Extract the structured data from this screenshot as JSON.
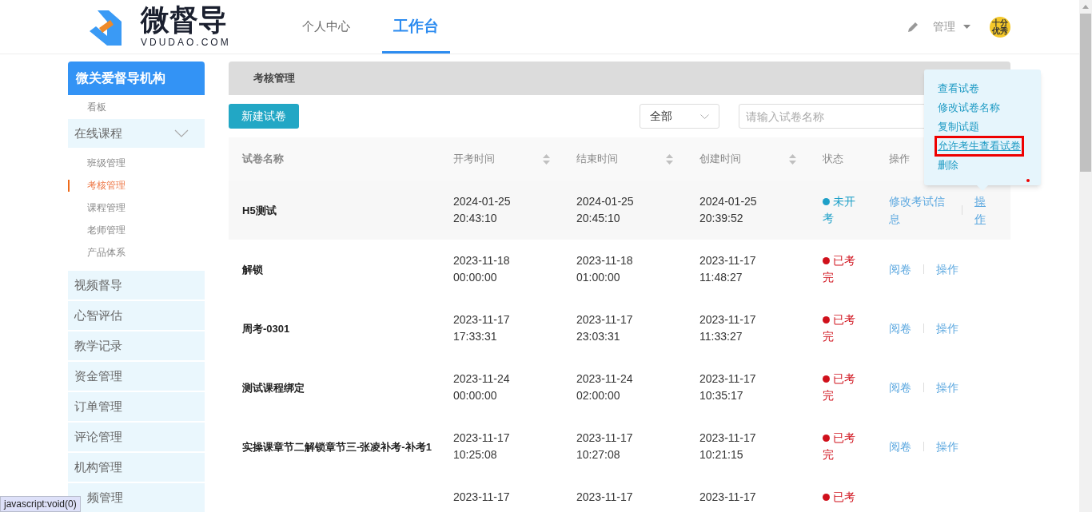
{
  "header": {
    "logo": {
      "name": "微督导",
      "domain": "VDUDAO.COM"
    },
    "nav": [
      {
        "label": "个人中心",
        "selected": false
      },
      {
        "label": "工作台",
        "selected": true
      }
    ],
    "user": {
      "menu": "管理",
      "avatar_text": "十分优秀"
    }
  },
  "sidebar": {
    "org": "微关爱督导机构",
    "items": [
      {
        "kind": "sub",
        "label": "看板",
        "selected": false
      },
      {
        "kind": "group",
        "label": "在线课程",
        "expanded": true,
        "children": [
          {
            "label": "班级管理",
            "selected": false
          },
          {
            "label": "考核管理",
            "selected": true
          },
          {
            "label": "课程管理",
            "selected": false
          },
          {
            "label": "老师管理",
            "selected": false
          },
          {
            "label": "产品体系",
            "selected": false
          }
        ]
      },
      {
        "kind": "item",
        "label": "视频督导",
        "selected": false
      },
      {
        "kind": "item",
        "label": "心智评估",
        "selected": false
      },
      {
        "kind": "item",
        "label": "教学记录",
        "selected": false
      },
      {
        "kind": "item",
        "label": "资金管理",
        "selected": false
      },
      {
        "kind": "item",
        "label": "订单管理",
        "selected": false
      },
      {
        "kind": "item",
        "label": "评论管理",
        "selected": false
      },
      {
        "kind": "item",
        "label": "机构管理",
        "selected": false
      },
      {
        "kind": "item",
        "label": "频管理",
        "selected": false,
        "covered": true
      }
    ]
  },
  "page": {
    "title": "考核管理",
    "new_button": "新建试卷",
    "filter": {
      "value": "全部"
    },
    "search": {
      "placeholder": "请输入试卷名称"
    },
    "table": {
      "columns": [
        {
          "label": "试卷名称",
          "sortable": false
        },
        {
          "label": "开考时间",
          "sortable": true
        },
        {
          "label": "结束时间",
          "sortable": true
        },
        {
          "label": "创建时间",
          "sortable": true
        },
        {
          "label": "状态",
          "sortable": false
        },
        {
          "label": "操作",
          "sortable": false
        }
      ],
      "rows": [
        {
          "name": "H5测试",
          "start": "2024-01-25 20:43:10",
          "end": "2024-01-25 20:45:10",
          "created": "2024-01-25 20:39:52",
          "status": {
            "label": "未开考",
            "color": "#1ea0c8"
          },
          "hovered": true,
          "actions": [
            {
              "label": "修改考试信息",
              "active": false
            },
            {
              "label": "操作",
              "active": true
            }
          ]
        },
        {
          "name": "解锁",
          "start": "2023-11-18 00:00:00",
          "end": "2023-11-18 01:00:00",
          "created": "2023-11-17 11:48:27",
          "status": {
            "label": "已考完",
            "color": "#d0101b"
          },
          "actions": [
            {
              "label": "阅卷",
              "active": false
            },
            {
              "label": "操作",
              "active": false
            }
          ]
        },
        {
          "name": "周考-0301",
          "start": "2023-11-17 17:33:31",
          "end": "2023-11-17 23:03:31",
          "created": "2023-11-17 11:33:27",
          "status": {
            "label": "已考完",
            "color": "#d0101b"
          },
          "actions": [
            {
              "label": "阅卷",
              "active": false
            },
            {
              "label": "操作",
              "active": false
            }
          ]
        },
        {
          "name": "测试课程绑定",
          "start": "2023-11-24 00:00:00",
          "end": "2023-11-24 02:00:00",
          "created": "2023-11-17 10:35:17",
          "status": {
            "label": "已考完",
            "color": "#d0101b"
          },
          "actions": [
            {
              "label": "阅卷",
              "active": false
            },
            {
              "label": "操作",
              "active": false
            }
          ]
        },
        {
          "name": "实操课章节二解锁章节三-张凌补考-补考1",
          "start": "2023-11-17 10:25:08",
          "end": "2023-11-17 10:27:08",
          "created": "2023-11-17 10:21:15",
          "status": {
            "label": "已考完",
            "color": "#d0101b"
          },
          "actions": [
            {
              "label": "阅卷",
              "active": false
            },
            {
              "label": "操作",
              "active": false
            }
          ]
        },
        {
          "start": "2023-11-17",
          "end": "2023-11-17",
          "created": "2023-11-17",
          "status": {
            "label": "已考",
            "color": "#d0101b"
          }
        }
      ]
    }
  },
  "popup_menu": [
    {
      "label": "查看试卷",
      "highlighted": false
    },
    {
      "label": "修改试卷名称",
      "highlighted": false
    },
    {
      "label": "复制试题",
      "highlighted": false
    },
    {
      "label": "允许考生查看试卷",
      "highlighted": true
    },
    {
      "label": "删除",
      "highlighted": false
    }
  ],
  "browser_status": "javascript:void(0)"
}
